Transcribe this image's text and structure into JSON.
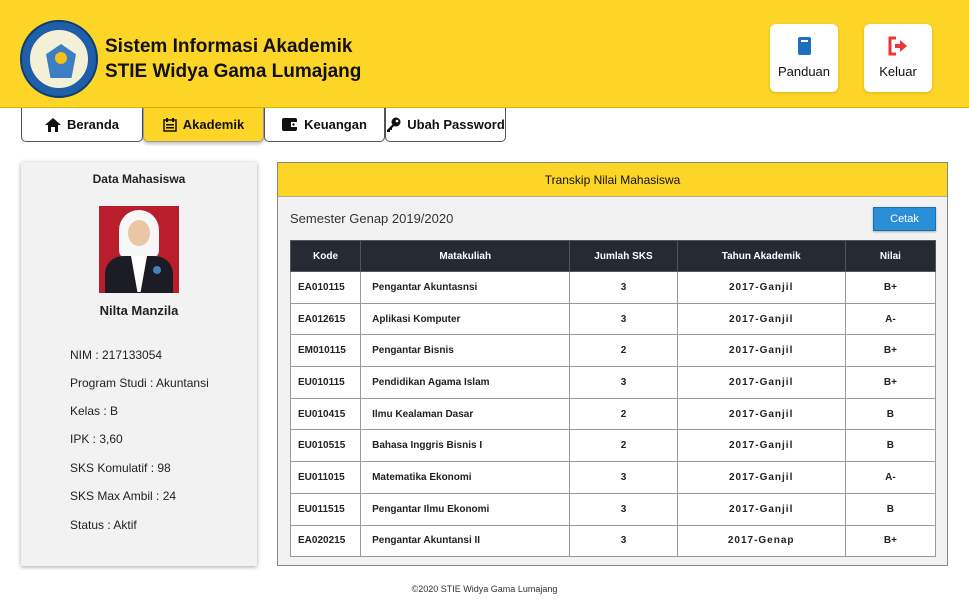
{
  "header": {
    "title_line1": "Sistem Informasi Akademik",
    "title_line2": "STIE Widya Gama Lumajang",
    "logo_name": "stie-logo",
    "buttons": {
      "panduan": {
        "label": "Panduan",
        "icon": "book-icon",
        "color": "#1f6fbf"
      },
      "keluar": {
        "label": "Keluar",
        "icon": "sign-out-icon",
        "color": "#e53935"
      }
    }
  },
  "tabs": [
    {
      "label": "Beranda",
      "icon": "home-icon",
      "active": false
    },
    {
      "label": "Akademik",
      "icon": "calendar-icon",
      "active": true
    },
    {
      "label": "Keuangan",
      "icon": "wallet-icon",
      "active": false
    },
    {
      "label": "Ubah Password",
      "icon": "key-icon",
      "active": false
    }
  ],
  "student": {
    "card_title": "Data Mahasiswa",
    "name": "Nilta Manzila",
    "fields": [
      "NIM : 217133054",
      "Program Studi : Akuntansi",
      "Kelas : B",
      "IPK : 3,60",
      "SKS Komulatif : 98",
      "SKS Max Ambil : 24",
      "Status : Aktif"
    ]
  },
  "transcript": {
    "panel_title": "Transkip Nilai Mahasiswa",
    "semester": "Semester Genap 2019/2020",
    "print_label": "Cetak",
    "columns": [
      "Kode",
      "Matakuliah",
      "Jumlah SKS",
      "Tahun Akademik",
      "Nilai"
    ],
    "rows": [
      [
        "EA010115",
        "Pengantar Akuntasnsi",
        "3",
        "2017-Ganjil",
        "B+"
      ],
      [
        "EA012615",
        "Aplikasi Komputer",
        "3",
        "2017-Ganjil",
        "A-"
      ],
      [
        "EM010115",
        "Pengantar Bisnis",
        "2",
        "2017-Ganjil",
        "B+"
      ],
      [
        "EU010115",
        "Pendidikan Agama Islam",
        "3",
        "2017-Ganjil",
        "B+"
      ],
      [
        "EU010415",
        "Ilmu Kealaman Dasar",
        "2",
        "2017-Ganjil",
        "B"
      ],
      [
        "EU010515",
        "Bahasa Inggris Bisnis I",
        "2",
        "2017-Ganjil",
        "B"
      ],
      [
        "EU011015",
        "Matematika Ekonomi",
        "3",
        "2017-Ganjil",
        "A-"
      ],
      [
        "EU011515",
        "Pengantar Ilmu Ekonomi",
        "3",
        "2017-Ganjil",
        "B"
      ],
      [
        "EA020215",
        "Pengantar Akuntansi II",
        "3",
        "2017-Genap",
        "B+"
      ]
    ]
  },
  "footer": {
    "text": "©2020 STIE Widya Gama Lumajang"
  },
  "colors": {
    "brand_yellow": "#fcd526",
    "table_header": "#252a33",
    "print_button": "#2a8fd6"
  }
}
